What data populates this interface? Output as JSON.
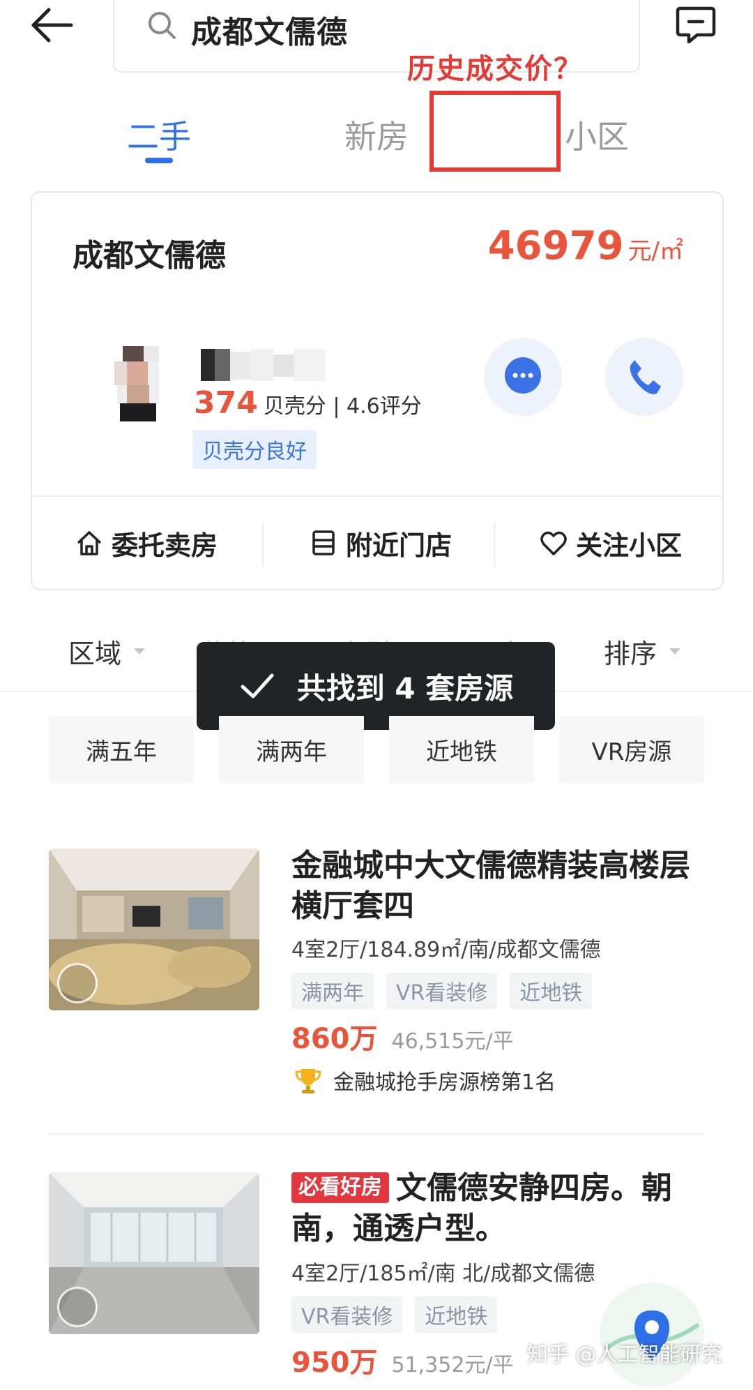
{
  "search": {
    "query": "成都文儒德"
  },
  "annotation": {
    "text": "历史成交价？"
  },
  "tabs": [
    {
      "label": "二手",
      "active": true
    },
    {
      "label": "新房",
      "active": false
    },
    {
      "label": "小区",
      "active": false
    }
  ],
  "community": {
    "name": "成都文儒德",
    "price": "46979",
    "price_unit": "元/㎡",
    "agent": {
      "score": "374",
      "score_text": "贝壳分 | 4.6评分",
      "badge": "贝壳分良好"
    },
    "actions": [
      {
        "label": "委托卖房",
        "icon": "house-icon"
      },
      {
        "label": "附近门店",
        "icon": "store-icon"
      },
      {
        "label": "关注小区",
        "icon": "heart-icon"
      }
    ]
  },
  "filters": [
    {
      "label": "区域"
    },
    {
      "label": "价格"
    },
    {
      "label": "房型"
    },
    {
      "label": "更多"
    },
    {
      "label": "排序"
    }
  ],
  "toast": {
    "text": "共找到 4 套房源"
  },
  "quick_tags": [
    "满五年",
    "满两年",
    "近地铁",
    "VR房源"
  ],
  "listings": [
    {
      "title": "金融城中大文儒德精装高楼层横厅套四",
      "spec": "4室2厅/184.89㎡/南/成都文儒德",
      "tags": [
        "满两年",
        "VR看装修",
        "近地铁"
      ],
      "price": "860万",
      "unit_price": "46,515元/平",
      "rank": "金融城抢手房源榜第1名"
    },
    {
      "badge": "必看好房",
      "title": "文儒德安静四房。朝南，通透户型。",
      "spec": "4室2厅/185㎡/南 北/成都文儒德",
      "tags": [
        "VR看装修",
        "近地铁"
      ],
      "price": "950万",
      "unit_price": "51,352元/平"
    }
  ],
  "watermark": "知乎 @人工智能研究",
  "colors": {
    "accent": "#2f6fe8",
    "price": "#e8553a",
    "annotation": "#e53935"
  }
}
